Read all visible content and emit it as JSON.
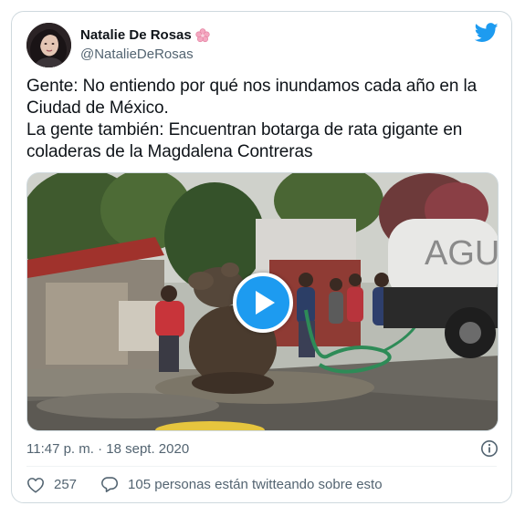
{
  "tweet": {
    "author": {
      "display_name": "Natalie De Rosas",
      "name_emoji": "cherry-blossom-emoji",
      "handle": "@NatalieDeRosas",
      "avatar": "avatar-photo"
    },
    "logo": "twitter-bird-icon",
    "text": "Gente: No entiendo por qué nos inundamos cada año en la Ciudad de México.\nLa gente también: Encuentran botarga de rata gigante en coladeras de la Magdalena Contreras",
    "media": {
      "type": "video",
      "play_icon": "play-icon",
      "truck_lettering": "AGU"
    },
    "timestamp": "11:47 p. m. · 18 sept. 2020",
    "info_icon": "info-icon",
    "likes": {
      "icon": "heart-icon",
      "count": "257"
    },
    "conversation": {
      "icon": "speech-bubble-icon",
      "label": "105 personas están twitteando sobre esto"
    }
  },
  "colors": {
    "accent": "#1d9bf0",
    "text": "#0f1419",
    "secondary_text": "#536471",
    "border": "#cfd9de"
  }
}
